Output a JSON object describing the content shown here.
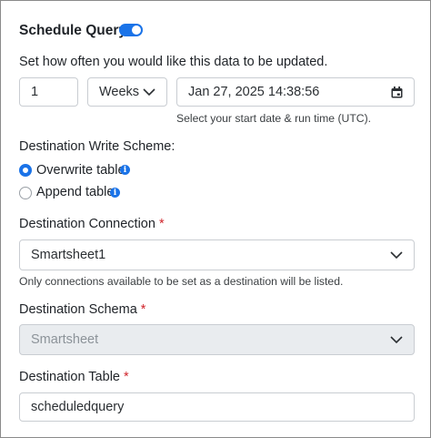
{
  "schedule": {
    "title": "Schedule Query",
    "toggle_on": true,
    "description": "Set how often you would like this data to be updated.",
    "interval_value": "1",
    "interval_unit": "Weeks",
    "start_datetime": "Jan 27, 2025 14:38:56",
    "start_hint": "Select your start date & run time (UTC)."
  },
  "write_scheme": {
    "label": "Destination Write Scheme:",
    "options": [
      {
        "label": "Overwrite table",
        "selected": true
      },
      {
        "label": "Append table",
        "selected": false
      }
    ]
  },
  "connection": {
    "label": "Destination Connection",
    "required_mark": "*",
    "value": "Smartsheet1",
    "hint": "Only connections available to be set as a destination will be listed."
  },
  "schema": {
    "label": "Destination Schema",
    "required_mark": "*",
    "value": "Smartsheet"
  },
  "table": {
    "label": "Destination Table",
    "required_mark": "*",
    "value": "scheduledquery"
  },
  "icons": {
    "toggle": "toggle-switch",
    "chevron": "chevron-down-icon",
    "calendar": "calendar-icon",
    "info": "info-icon"
  },
  "colors": {
    "accent": "#1a73e8",
    "required": "#d0242b",
    "disabled_bg": "#e9ecef"
  }
}
